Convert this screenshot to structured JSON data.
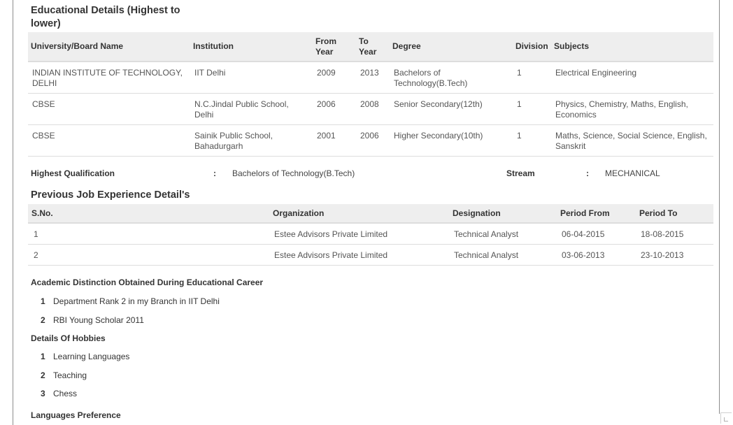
{
  "education": {
    "title": "Educational Details (Highest to lower)",
    "columns": [
      "University/Board Name",
      "Institution",
      "From Year",
      "To Year",
      "Degree",
      "Division",
      "Subjects"
    ],
    "rows": [
      [
        "INDIAN INSTITUTE OF TECHNOLOGY, DELHI",
        "IIT Delhi",
        "2009",
        "2013",
        "Bachelors of Technology(B.Tech)",
        "1",
        "Electrical Engineering"
      ],
      [
        "CBSE",
        "N.C.Jindal Public School, Delhi",
        "2006",
        "2008",
        "Senior Secondary(12th)",
        "1",
        "Physics, Chemistry, Maths, English, Economics"
      ],
      [
        "CBSE",
        "Sainik Public School, Bahadurgarh",
        "2001",
        "2006",
        "Higher Secondary(10th)",
        "1",
        "Maths, Science, Social Science, English, Sanskrit"
      ]
    ]
  },
  "qualification": {
    "highest_label": "Highest Qualification",
    "separator": ":",
    "highest_value": "Bachelors of Technology(B.Tech)",
    "stream_label": "Stream",
    "stream_value": "MECHANICAL"
  },
  "jobs": {
    "title": "Previous Job Experience Detail's",
    "columns": [
      "S.No.",
      "Organization",
      "Designation",
      "Period From",
      "Period To"
    ],
    "rows": [
      [
        "1",
        "Estee Advisors Private Limited",
        "Technical Analyst",
        "06-04-2015",
        "18-08-2015"
      ],
      [
        "2",
        "Estee Advisors Private Limited",
        "Technical Analyst",
        "03-06-2013",
        "23-10-2013"
      ]
    ]
  },
  "distinctions": {
    "title": "Academic Distinction Obtained During Educational Career",
    "items": [
      {
        "n": "1",
        "text": "Department Rank 2 in my Branch in IIT Delhi"
      },
      {
        "n": "2",
        "text": "RBI Young Scholar 2011"
      }
    ]
  },
  "hobbies": {
    "title": "Details Of Hobbies",
    "items": [
      {
        "n": "1",
        "text": "Learning Languages"
      },
      {
        "n": "2",
        "text": "Teaching"
      },
      {
        "n": "3",
        "text": "Chess"
      }
    ]
  },
  "languages": {
    "title": "Languages Preference"
  }
}
